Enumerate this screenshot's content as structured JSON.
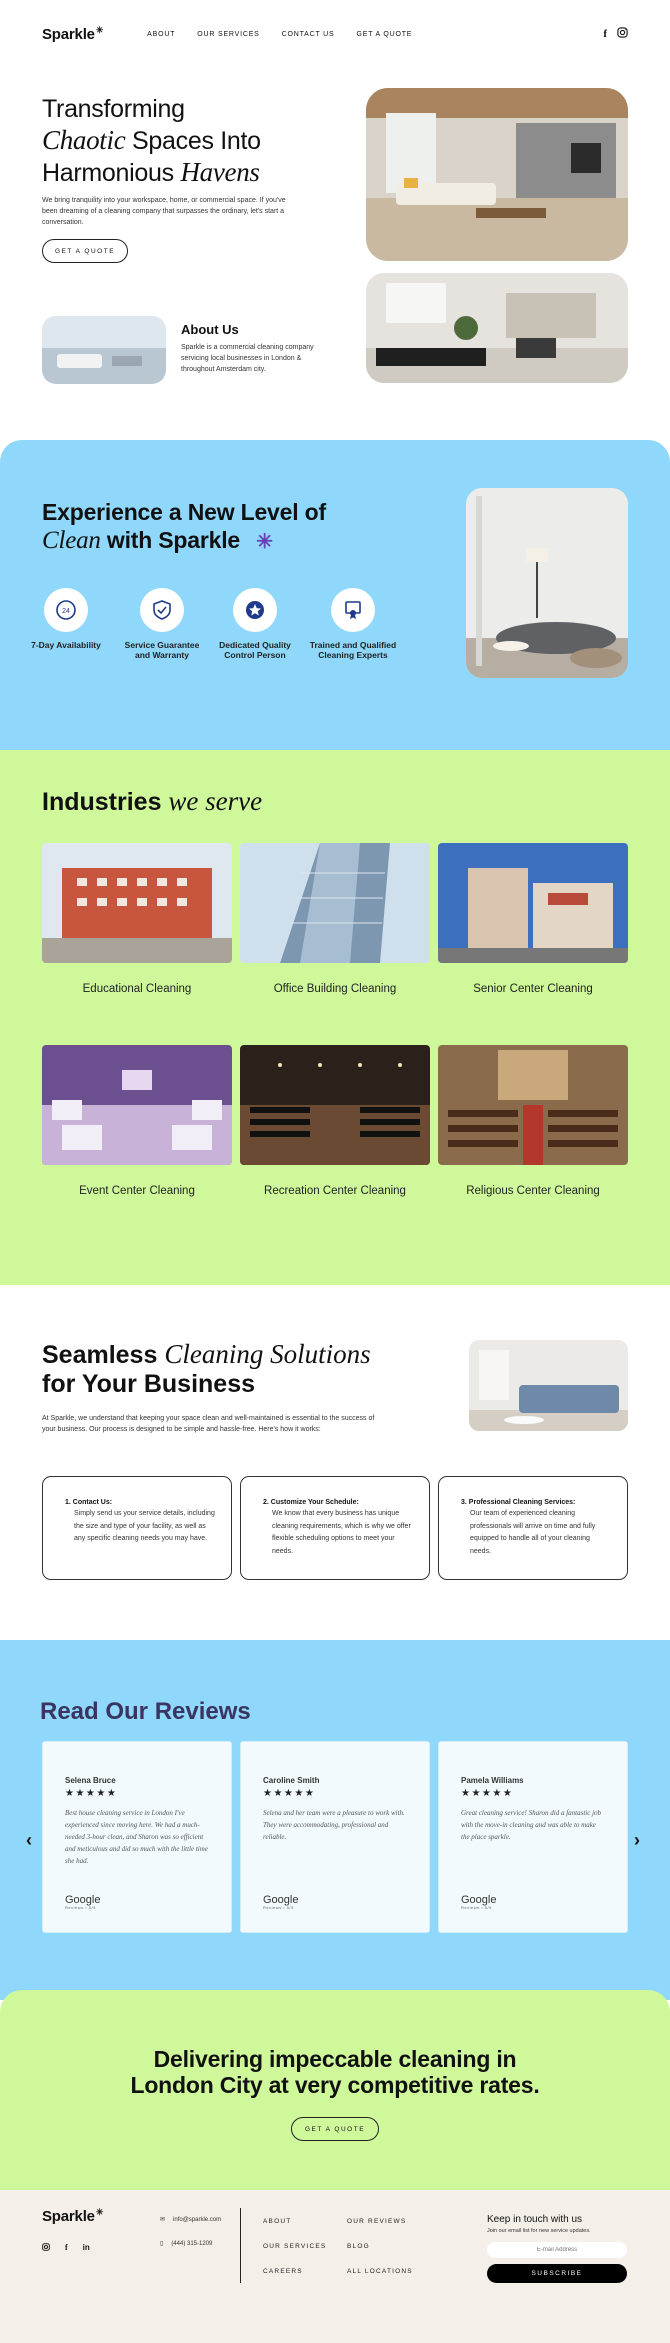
{
  "header": {
    "logo": "Sparkle",
    "nav": [
      "ABOUT",
      "OUR SERVICES",
      "CONTACT US",
      "GET A QUOTE"
    ]
  },
  "hero": {
    "line1": "Transforming",
    "line2_italic": "Chaotic",
    "line2_rest": " Spaces Into",
    "line3": "Harmonious ",
    "line3_italic": "Havens",
    "text": "We bring tranquility into your workspace, home, or commercial space. If you've been dreaming of a cleaning company that surpasses the ordinary, let's start a conversation.",
    "button": "GET A QUOTE"
  },
  "about": {
    "title": "About Us",
    "text": "Sparkle is a commercial cleaning company servicing local businesses in London & throughout Amsterdam city."
  },
  "experience": {
    "line1": "Experience a New Level of",
    "line2_italic": "Clean",
    "line2_rest": " with Sparkle",
    "features": [
      {
        "label": "7-Day Availability",
        "icon": "clock-24-icon"
      },
      {
        "label": "Service Guarantee and Warranty",
        "icon": "shield-check-icon"
      },
      {
        "label": "Dedicated Quality Control Person",
        "icon": "star-badge-icon"
      },
      {
        "label": "Trained and Qualified Cleaning Experts",
        "icon": "certificate-icon"
      }
    ]
  },
  "industries": {
    "title": "Industries ",
    "title_italic": "we serve",
    "items": [
      {
        "label": "Educational Cleaning"
      },
      {
        "label": "Office Building Cleaning"
      },
      {
        "label": "Senior Center Cleaning"
      },
      {
        "label": "Event Center Cleaning"
      },
      {
        "label": "Recreation Center Cleaning"
      },
      {
        "label": "Religious Center Cleaning"
      }
    ]
  },
  "seamless": {
    "line1": "Seamless ",
    "line1_italic": "Cleaning Solutions",
    "line2": "for Your Business",
    "text": "At Sparkle, we understand that keeping your space clean and well-maintained is essential to the success of your business. Our process is designed to be simple and hassle-free. Here's how it works:",
    "steps": [
      {
        "num": "1.",
        "title": "Contact Us:",
        "text": "Simply send us your service details, including the size and type of your facility, as well as any specific cleaning needs you may have."
      },
      {
        "num": "2.",
        "title": "Customize Your Schedule:",
        "text": "We know that every business has unique cleaning requirements, which is why we offer flexible scheduling options to meet your needs."
      },
      {
        "num": "3.",
        "title": "Professional Cleaning Services:",
        "text": "Our team of experienced cleaning professionals will arrive on time and fully equipped to handle all of your cleaning needs."
      }
    ]
  },
  "reviews": {
    "title": "Read Our Reviews",
    "items": [
      {
        "name": "Selena Bruce",
        "stars": "★★★★★",
        "text": "Best house cleaning service in London I've experienced since moving here. We had a much-needed 3-hour clean, and Sharon was so efficient and meticulous and did so much with the little time she had.",
        "source": "Google",
        "source_sub": "Reviews • 5/5"
      },
      {
        "name": "Caroline Smith",
        "stars": "★★★★★",
        "text": "Selena and her team were a pleasure to work with. They were accommodating, professional and reliable.",
        "source": "Google",
        "source_sub": "Reviews • 5/5"
      },
      {
        "name": "Pamela Williams",
        "stars": "★★★★★",
        "text": "Great cleaning service! Sharon did a fantastic job with the move-in cleaning and was able to make the place sparkle.",
        "source": "Google",
        "source_sub": "Reviews • 5/5"
      }
    ]
  },
  "cta": {
    "line1": "Delivering impeccable cleaning in",
    "line2": "London City at very competitive rates.",
    "button": "GET A QUOTE"
  },
  "footer": {
    "logo": "Sparkle",
    "email": "info@sparkle.com",
    "phone": "(444) 315-1209",
    "links_col1": [
      "ABOUT",
      "OUR SERVICES",
      "CAREERS"
    ],
    "links_col2": [
      "OUR REVIEWS",
      "BLOG",
      "ALL LOCATIONS"
    ],
    "newsletter_title": "Keep in touch with us",
    "newsletter_text": "Join our email list for new service updates.",
    "email_placeholder": "E-mail Address",
    "subscribe": "SUBSCRIBE"
  },
  "colors": {
    "blue": "#8fd8fb",
    "green": "#cff89b",
    "navy": "#1f3a8a",
    "footer_bg": "#f5efe9"
  }
}
